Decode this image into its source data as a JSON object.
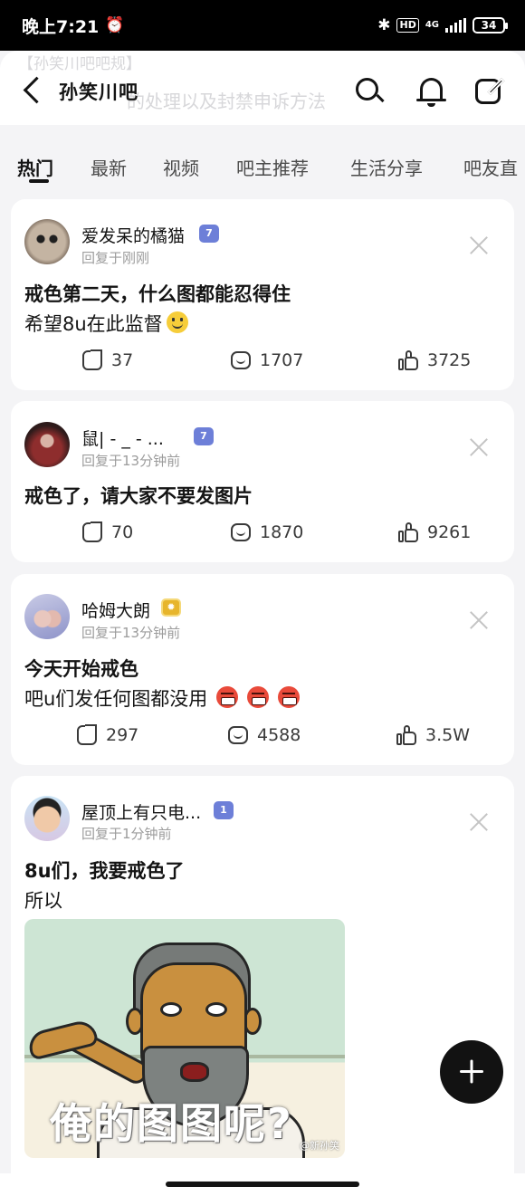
{
  "status_bar": {
    "time": "晚上7:21",
    "network": "4G",
    "battery": "34"
  },
  "header": {
    "title": "孙笑川吧",
    "ghost_notice_1": "【孙笑川吧吧规】",
    "ghost_notice_2": "的处理以及封禁申诉方法"
  },
  "tabs": [
    {
      "label": "热门",
      "active": true
    },
    {
      "label": "最新"
    },
    {
      "label": "视频"
    },
    {
      "label": "吧主推荐"
    },
    {
      "label": "生活分享"
    },
    {
      "label": "吧友直"
    }
  ],
  "posts": [
    {
      "author": "爱发呆的橘猫",
      "level": "7",
      "time": "回复于刚刚",
      "title": "戒色第二天，什么图都能忍得住",
      "body": "希望8u在此监督",
      "shares": "37",
      "comments": "1707",
      "likes": "3725"
    },
    {
      "author": "鼠| - _ - ...",
      "level": "7",
      "time": "回复于13分钟前",
      "title": "戒色了，请大家不要发图片",
      "body": "",
      "shares": "70",
      "comments": "1870",
      "likes": "9261"
    },
    {
      "author": "哈姆大朗",
      "level": "",
      "time": "回复于13分钟前",
      "title": "今天开始戒色",
      "body": "吧u们发任何图都没用",
      "shares": "297",
      "comments": "4588",
      "likes": "3.5W"
    },
    {
      "author": "屋顶上有只电...",
      "level": "1",
      "time": "回复于1分钟前",
      "title": "8u们，我要戒色了",
      "body": "所以",
      "image_caption": "俺的图图呢?",
      "image_watermark": "@新孙笑"
    }
  ],
  "colors": {
    "background": "#f4f4f6",
    "card": "#ffffff",
    "fab": "#121212",
    "level_badge": "#6d7fd8"
  }
}
